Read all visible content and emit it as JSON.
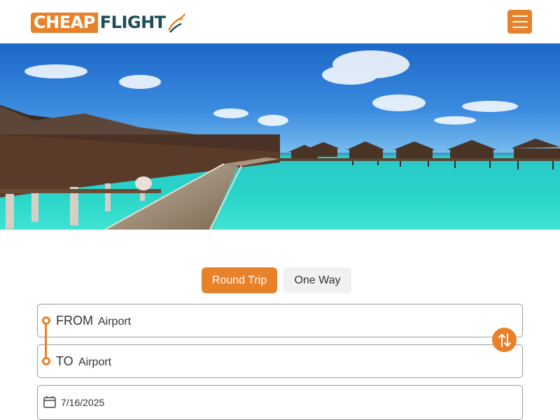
{
  "header": {
    "logo_cheap": "CHEAP",
    "logo_flight": "FLIGHT",
    "menu_icon": "hamburger-menu-icon"
  },
  "colors": {
    "accent": "#e8822a",
    "brand_dark": "#1d4e57",
    "field_border": "#9a9a9a",
    "inactive_bg": "#f1f1f1"
  },
  "hero": {
    "description_icon": "hero-image"
  },
  "trip_type": {
    "options": [
      "Round Trip",
      "One Way"
    ],
    "selected": "Round Trip"
  },
  "search": {
    "from_label": "FROM",
    "from_value": "Airport",
    "to_label": "TO",
    "to_value": "Airport",
    "swap_icon": "swap-arrows-icon",
    "date_icon": "calendar-icon",
    "date_value": "7/16/2025"
  }
}
